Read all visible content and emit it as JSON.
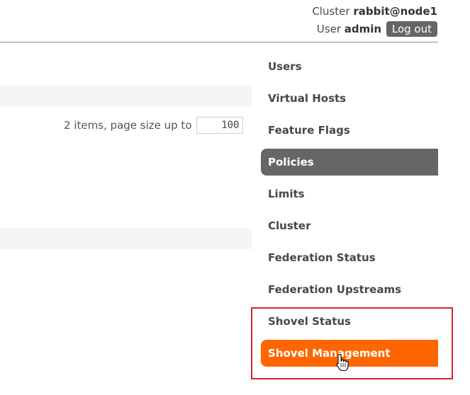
{
  "header": {
    "cluster_label": "Cluster",
    "cluster_name": "rabbit@node1",
    "user_label": "User",
    "user_name": "admin",
    "logout_label": "Log out"
  },
  "paging": {
    "text": "2 items, page size up to",
    "page_size": "100"
  },
  "nav": {
    "items": [
      {
        "label": "Users"
      },
      {
        "label": "Virtual Hosts"
      },
      {
        "label": "Feature Flags"
      },
      {
        "label": "Policies"
      },
      {
        "label": "Limits"
      },
      {
        "label": "Cluster"
      },
      {
        "label": "Federation Status"
      },
      {
        "label": "Federation Upstreams"
      },
      {
        "label": "Shovel Status"
      },
      {
        "label": "Shovel Management"
      }
    ]
  },
  "colors": {
    "selected_bg": "#666666",
    "hover_bg": "#ff6600",
    "highlight_border": "#e0202a"
  }
}
